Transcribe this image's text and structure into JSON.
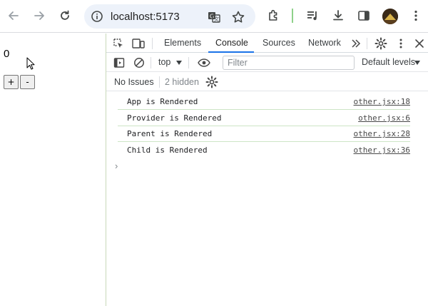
{
  "browser": {
    "url": "localhost:5173",
    "icons": [
      "back-icon",
      "forward-icon",
      "reload-icon",
      "info-icon",
      "translate-icon",
      "star-icon",
      "extensions-icon",
      "media-control-icon",
      "download-icon",
      "side-panel-icon",
      "profile-avatar",
      "menu-icon"
    ]
  },
  "page": {
    "count": "0",
    "increment_label": "+",
    "decrement_label": "-"
  },
  "devtools": {
    "tabs": [
      "Elements",
      "Console",
      "Sources",
      "Network"
    ],
    "active_tab": "Console",
    "context": "top",
    "filter_placeholder": "Filter",
    "levels": "Default levels",
    "issues": "No Issues",
    "hidden": "2 hidden",
    "prompt_symbol": "›",
    "logs": [
      {
        "message": "App is Rendered",
        "source": "other.jsx:18"
      },
      {
        "message": "Provider is Rendered",
        "source": "other.jsx:6"
      },
      {
        "message": "Parent is Rendered",
        "source": "other.jsx:28"
      },
      {
        "message": "Child is Rendered",
        "source": "other.jsx:36"
      }
    ],
    "accent_color": "#1a73e8"
  }
}
